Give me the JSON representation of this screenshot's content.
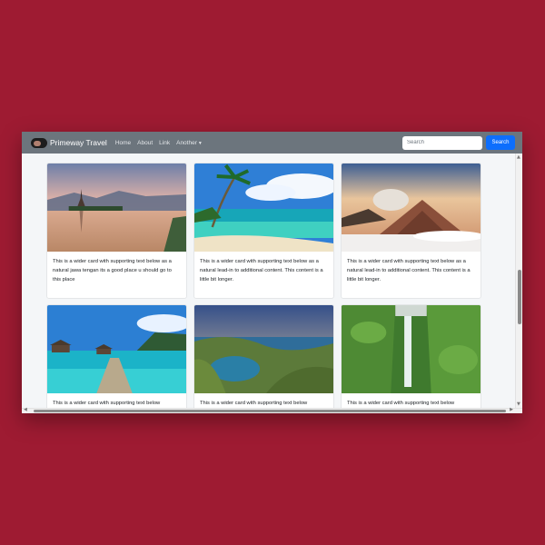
{
  "navbar": {
    "brand": "Primeway Travel",
    "links": [
      "Home",
      "About",
      "Link",
      "Another"
    ],
    "dropdown_icon": "caret-down-icon",
    "search_placeholder": "Search",
    "search_button": "Search"
  },
  "cards": [
    {
      "image": "bali-temple-lake-photo",
      "text": "This is a wider card with supporting text below as a natural jawa tengan its a good place u should go to this place"
    },
    {
      "image": "tropical-beach-palm-photo",
      "text": "This is a wider card with supporting text below as a natural lead-in to additional content. This content is a little bit longer."
    },
    {
      "image": "volcano-sunrise-photo",
      "text": "This is a wider card with supporting text below as a natural lead-in to additional content. This content is a little bit longer."
    },
    {
      "image": "pier-turquoise-sea-photo",
      "text": "This is a wider card with supporting text below"
    },
    {
      "image": "island-bay-viewpoint-photo",
      "text": "This is a wider card with supporting text below"
    },
    {
      "image": "jungle-waterfall-photo",
      "text": "This is a wider card with supporting text below"
    }
  ],
  "colors": {
    "page_background": "#9e1b32",
    "navbar": "#6c757d",
    "primary_button": "#0d6efd"
  }
}
